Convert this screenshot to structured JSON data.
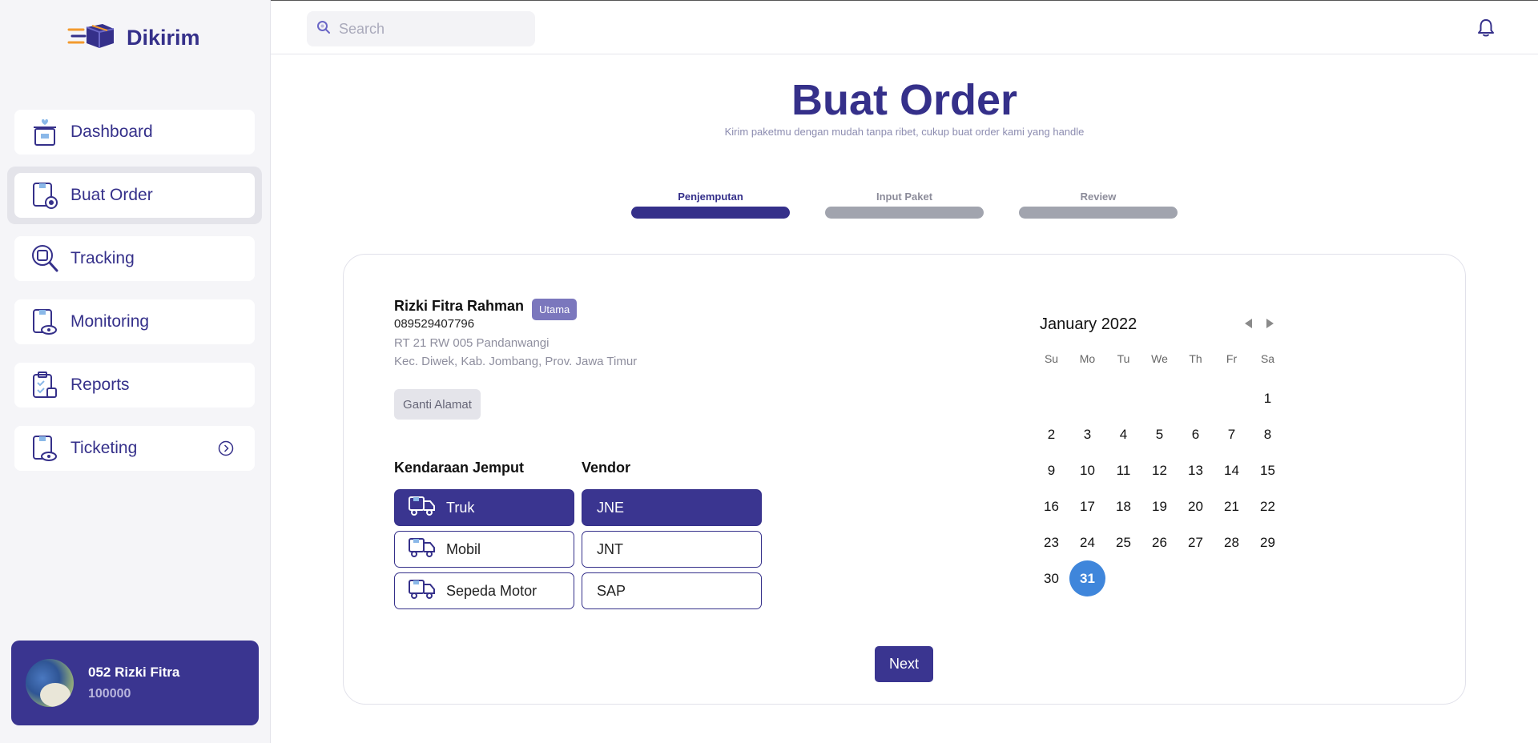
{
  "app": {
    "name": "Dikirim"
  },
  "colors": {
    "primary": "#3a3590",
    "accent_selected_day": "#3f86db"
  },
  "sidebar": {
    "items": [
      {
        "label": "Dashboard",
        "icon": "gift-box-icon"
      },
      {
        "label": "Buat Order",
        "icon": "order-icon",
        "active": true
      },
      {
        "label": "Tracking",
        "icon": "magnifier-box-icon"
      },
      {
        "label": "Monitoring",
        "icon": "monitor-eye-icon"
      },
      {
        "label": "Reports",
        "icon": "clipboard-check-icon"
      },
      {
        "label": "Ticketing",
        "icon": "ticket-eye-icon",
        "has_chevron": true
      }
    ],
    "profile": {
      "name": "052 Rizki Fitra",
      "id": "100000"
    }
  },
  "topbar": {
    "search_placeholder": "Search"
  },
  "page": {
    "title": "Buat Order",
    "subtitle": "Kirim paketmu dengan mudah tanpa ribet, cukup buat order kami yang handle"
  },
  "steps": [
    {
      "label": "Penjemputan",
      "active": true
    },
    {
      "label": "Input Paket",
      "active": false
    },
    {
      "label": "Review",
      "active": false
    }
  ],
  "address": {
    "name": "Rizki Fitra Rahman",
    "badge": "Utama",
    "phone": "089529407796",
    "line1": "RT 21 RW 005 Pandanwangi",
    "line2": "Kec. Diwek, Kab. Jombang, Prov. Jawa Timur",
    "change_button": "Ganti Alamat"
  },
  "vehicle": {
    "heading": "Kendaraan Jemput",
    "options": [
      "Truk",
      "Mobil",
      "Sepeda Motor"
    ],
    "selected": "Truk"
  },
  "vendor": {
    "heading": "Vendor",
    "options": [
      "JNE",
      "JNT",
      "SAP"
    ],
    "selected": "JNE"
  },
  "calendar": {
    "month_label": "January 2022",
    "weekdays": [
      "Su",
      "Mo",
      "Tu",
      "We",
      "Th",
      "Fr",
      "Sa"
    ],
    "first_weekday_index": 6,
    "days_in_month": 31,
    "selected_day": 31
  },
  "next_button": "Next"
}
